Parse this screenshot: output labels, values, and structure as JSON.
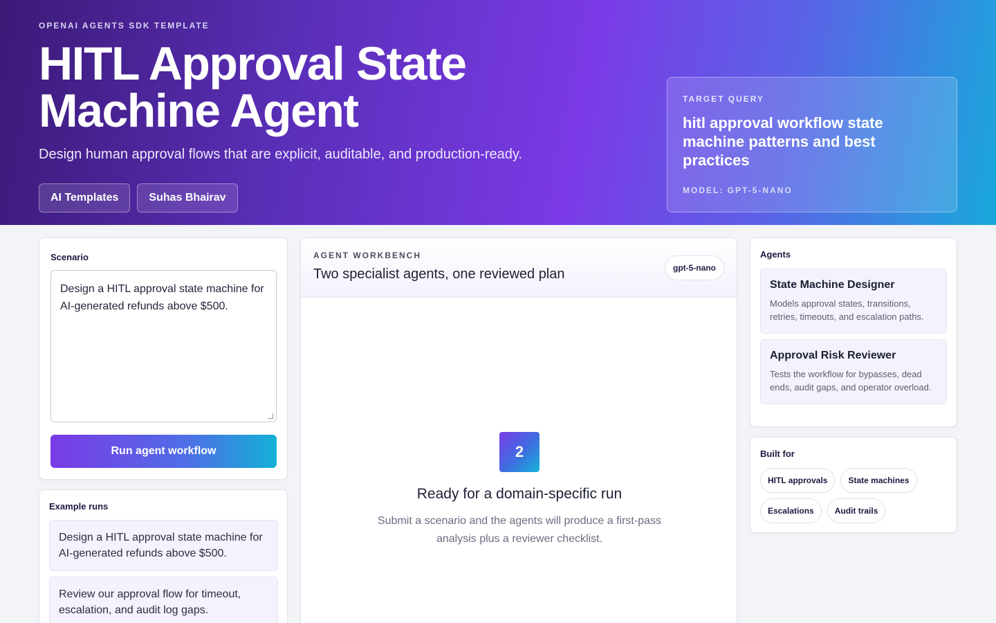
{
  "hero": {
    "eyebrow": "OPENAI AGENTS SDK TEMPLATE",
    "title": "HITL Approval State Machine Agent",
    "subtitle": "Design human approval flows that are explicit, auditable, and production-ready.",
    "links": [
      "AI Templates",
      "Suhas Bhairav"
    ],
    "query": {
      "label": "TARGET QUERY",
      "text": "hitl approval workflow state machine patterns and best practices",
      "model": "MODEL: GPT-5-NANO"
    }
  },
  "scenario": {
    "title": "Scenario",
    "value": "Design a HITL approval state machine for AI-generated refunds above $500.",
    "run_label": "Run agent workflow"
  },
  "examples": {
    "title": "Example runs",
    "items": [
      "Design a HITL approval state machine for AI-generated refunds above $500.",
      "Review our approval flow for timeout, escalation, and audit log gaps."
    ]
  },
  "workbench": {
    "eyebrow": "AGENT WORKBENCH",
    "title": "Two specialist agents, one reviewed plan",
    "model_chip": "gpt-5-nano",
    "empty": {
      "badge": "2",
      "title": "Ready for a domain-specific run",
      "desc": "Submit a scenario and the agents will produce a first-pass analysis plus a reviewer checklist."
    }
  },
  "agents": {
    "title": "Agents",
    "items": [
      {
        "name": "State Machine Designer",
        "desc": "Models approval states, transitions, retries, timeouts, and escalation paths."
      },
      {
        "name": "Approval Risk Reviewer",
        "desc": "Tests the workflow for bypasses, dead ends, audit gaps, and operator overload."
      }
    ]
  },
  "built_for": {
    "title": "Built for",
    "tags": [
      "HITL approvals",
      "State machines",
      "Escalations",
      "Audit trails"
    ]
  },
  "colors": {
    "accent_purple": "#7a3ae6",
    "accent_cyan": "#14b0d6",
    "hero_dark": "#3b1a77"
  }
}
